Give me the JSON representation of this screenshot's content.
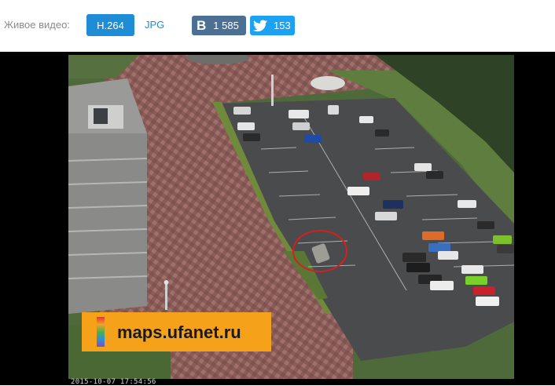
{
  "toolbar": {
    "live_label": "Живое видео:",
    "format_buttons": [
      {
        "label": "H.264",
        "active": true
      },
      {
        "label": "JPG",
        "active": false
      }
    ],
    "share": {
      "vk": {
        "icon": "vk-icon",
        "logo": "B",
        "count": "1 585"
      },
      "twitter": {
        "icon": "twitter-bird-icon",
        "count": "153"
      }
    }
  },
  "video": {
    "watermark_text": "maps.ufanet.ru",
    "timestamp": "2015-10-07 17:54:56"
  },
  "colors": {
    "accent": "#1f8dd6",
    "vk": "#4c6f94",
    "twitter": "#1da1f2",
    "watermark_bg": "#f5a21a",
    "highlight_circle": "#d81e1e"
  }
}
